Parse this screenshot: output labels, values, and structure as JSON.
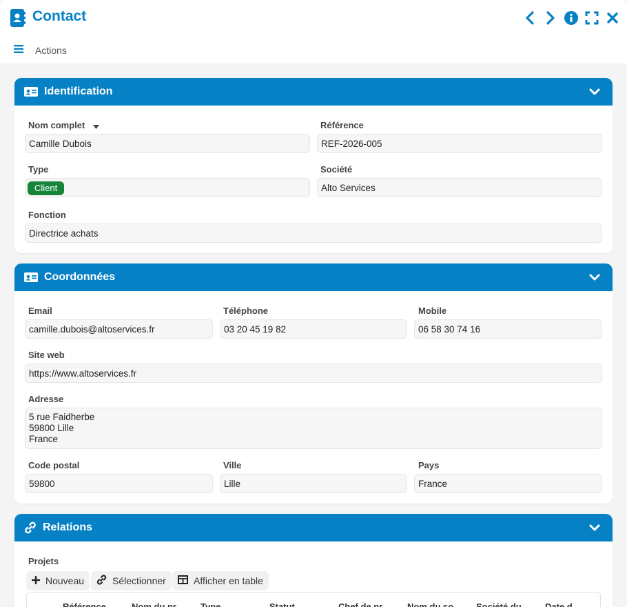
{
  "window": {
    "title": "Contact",
    "actions_label": "Actions"
  },
  "identification": {
    "title": "Identification",
    "nom_complet_label": "Nom complet",
    "nom_complet_value": "Camille Dubois",
    "reference_label": "Référence",
    "reference_value": "REF-2026-005",
    "type_label": "Type",
    "type_value": "Client",
    "societe_label": "Société",
    "societe_value": "Alto Services",
    "fonction_label": "Fonction",
    "fonction_value": "Directrice achats"
  },
  "coordonnees": {
    "title": "Coordonnées",
    "email_label": "Email",
    "email_value": "camille.dubois@altoservices.fr",
    "telephone_label": "Téléphone",
    "telephone_value": "03 20 45 19 82",
    "mobile_label": "Mobile",
    "mobile_value": "06 58 30 74 16",
    "site_label": "Site web",
    "site_value": "https://www.altoservices.fr",
    "adresse_label": "Adresse",
    "adresse_value": "5 rue Faidherbe\n59800 Lille\nFrance",
    "code_postal_label": "Code postal",
    "code_postal_value": "59800",
    "ville_label": "Ville",
    "ville_value": "Lille",
    "pays_label": "Pays",
    "pays_value": "France"
  },
  "relations": {
    "title": "Relations",
    "projets_label": "Projets",
    "buttons": {
      "nouveau": "Nouveau",
      "selectionner": "Sélectionner",
      "afficher_table": "Afficher en table"
    },
    "columns": [
      "Référence",
      "Nom du pr",
      "Type",
      "Statut",
      "Chef de pr",
      "Nom du so",
      "Société du",
      "Date d"
    ]
  },
  "colors": {
    "accent": "#0681c5",
    "badge_client": "#16853a"
  },
  "icons": [
    "contact-card-icon",
    "chevron-left-icon",
    "chevron-right-icon",
    "info-icon",
    "fullscreen-icon",
    "close-icon",
    "hamburger-icon",
    "id-card-icon",
    "link-icon",
    "plus-icon",
    "table-icon",
    "chevron-down-icon"
  ]
}
